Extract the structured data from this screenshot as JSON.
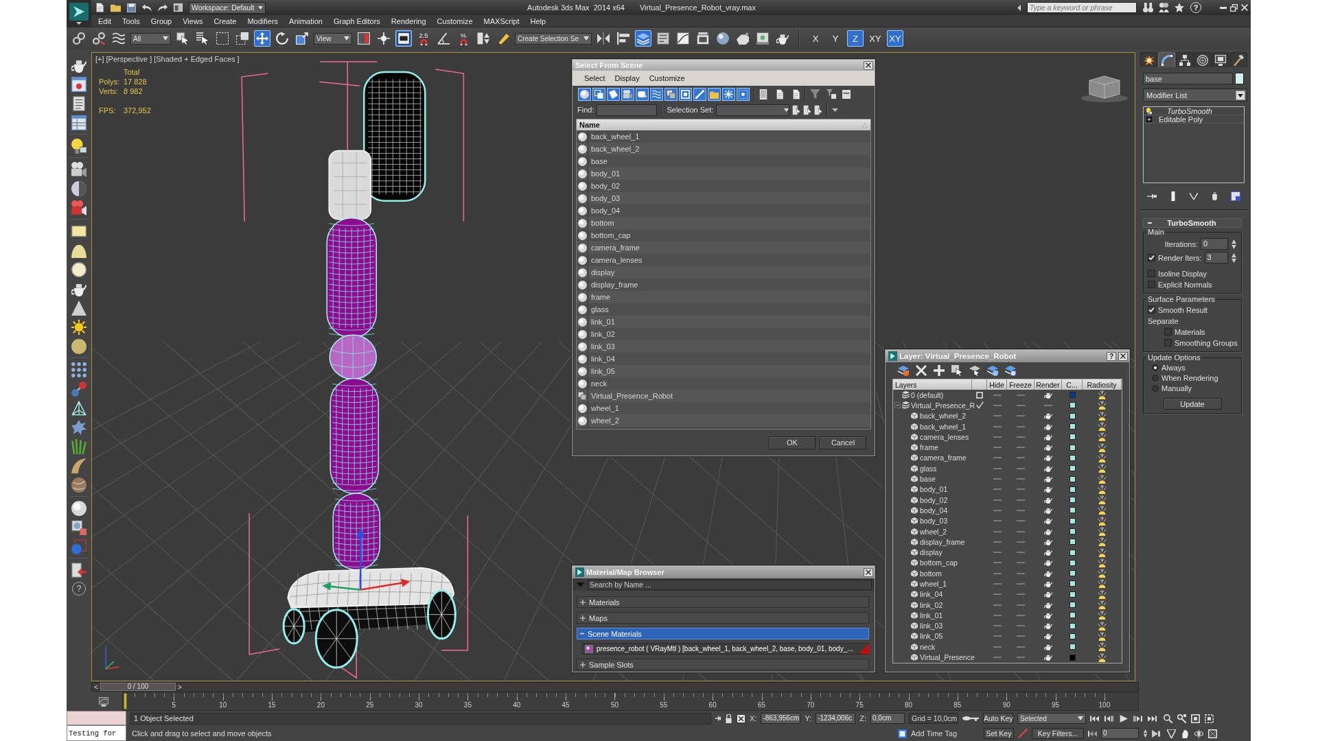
{
  "window": {
    "title": "Autodesk 3ds Max  2014 x64",
    "file": "Virtual_Presence_Robot_vray.max",
    "workspace": "Workspace: Default",
    "search": {
      "placeholder": "Type a keyword or phrase"
    },
    "help": "?"
  },
  "menu": [
    "Edit",
    "Tools",
    "Group",
    "Views",
    "Create",
    "Modifiers",
    "Animation",
    "Graph Editors",
    "Rendering",
    "Customize",
    "MAXScript",
    "Help"
  ],
  "toolbar": {
    "items": [
      {
        "kind": "tool",
        "selected": false
      },
      {
        "kind": "tool",
        "selected": false
      },
      {
        "kind": "tool",
        "selected": false
      },
      {
        "kind": "dropdown",
        "value": "All"
      },
      {
        "kind": "tool",
        "selected": false
      },
      {
        "kind": "tool",
        "selected": false
      },
      {
        "kind": "tool",
        "selected": false
      },
      {
        "kind": "tool",
        "selected": false
      },
      {
        "kind": "tool",
        "selected": true
      },
      {
        "kind": "tool",
        "selected": false
      },
      {
        "kind": "tool",
        "selected": false
      },
      {
        "kind": "dropdown",
        "value": "View"
      },
      {
        "kind": "tool",
        "selected": false
      },
      {
        "kind": "tool",
        "selected": false
      },
      {
        "kind": "tool",
        "selected": true
      },
      {
        "kind": "tool",
        "label": "2.5",
        "selected": false
      },
      {
        "kind": "tool",
        "selected": false
      },
      {
        "kind": "tool",
        "label": "%",
        "selected": false
      },
      {
        "kind": "tool",
        "selected": false
      },
      {
        "kind": "tool",
        "selected": false
      },
      {
        "kind": "dropdown",
        "value": "Create Selection Se"
      },
      {
        "kind": "tool",
        "selected": false
      },
      {
        "kind": "tool",
        "selected": false
      },
      {
        "kind": "tool",
        "selected": true
      },
      {
        "kind": "tool",
        "selected": false
      },
      {
        "kind": "tool",
        "selected": false
      },
      {
        "kind": "tool",
        "selected": false
      },
      {
        "kind": "tool",
        "selected": false
      },
      {
        "kind": "tool",
        "selected": false
      },
      {
        "kind": "tool",
        "selected": false
      },
      {
        "kind": "tool",
        "selected": false
      },
      {
        "kind": "axis",
        "label": "X",
        "selected": false
      },
      {
        "kind": "axis",
        "label": "Y",
        "selected": false
      },
      {
        "kind": "axis",
        "label": "Z",
        "selected": true
      },
      {
        "kind": "axis",
        "label": "XY",
        "selected": false
      },
      {
        "kind": "axis",
        "label": "XY",
        "selected": true
      }
    ]
  },
  "left_toolbar": {
    "help": "?"
  },
  "viewport": {
    "labels": [
      "[+]",
      "[Perspective ]",
      "[Shaded + Edged Faces ]"
    ],
    "stats": {
      "heading": "Total",
      "rows": [
        {
          "label": "Polys:",
          "value": "17 828"
        },
        {
          "label": "Verts:",
          "value": "8 982"
        }
      ],
      "fps_label": "FPS:",
      "fps": "372,952"
    }
  },
  "command_panel": {
    "tabs": [
      {
        "selected": false
      },
      {
        "selected": true
      },
      {
        "selected": false
      },
      {
        "selected": false
      },
      {
        "selected": false
      },
      {
        "selected": false
      }
    ],
    "object_name": "base",
    "modifier_list": "Modifier List",
    "stack": [
      {
        "name": "TurboSmooth",
        "kind": "modifier"
      },
      {
        "name": "Editable Poly",
        "kind": "object"
      }
    ],
    "rollout": {
      "title": "TurboSmooth",
      "expanded": true,
      "groups": [
        {
          "title": "Main",
          "controls": [
            {
              "kind": "spinner",
              "label": "Iterations:",
              "value": "0"
            },
            {
              "kind": "check-spinner",
              "label": "Render Iters:",
              "value": "3",
              "checked": true
            },
            {
              "kind": "checkbox",
              "label": "Isoline Display",
              "checked": false
            },
            {
              "kind": "checkbox",
              "label": "Explicit Normals",
              "checked": false
            }
          ]
        },
        {
          "title": "Surface Parameters",
          "controls": [
            {
              "kind": "checkbox",
              "label": "Smooth Result",
              "checked": true
            },
            {
              "kind": "label",
              "label": "Separate",
              "children": [
                {
                  "kind": "checkbox",
                  "label": "Materials",
                  "checked": false
                },
                {
                  "kind": "checkbox",
                  "label": "Smoothing Groups",
                  "checked": false
                }
              ]
            }
          ]
        },
        {
          "title": "Update Options",
          "controls": [
            {
              "kind": "radio",
              "label": "Always",
              "selected": true
            },
            {
              "kind": "radio",
              "label": "When Rendering",
              "selected": false
            },
            {
              "kind": "radio",
              "label": "Manually",
              "selected": false
            },
            {
              "kind": "button",
              "label": "Update"
            }
          ]
        }
      ]
    }
  },
  "select_dialog": {
    "title": "Select From Scene",
    "menu": [
      "Select",
      "Display",
      "Customize"
    ],
    "filters": [
      {
        "selected": true
      },
      {
        "selected": true
      },
      {
        "selected": true
      },
      {
        "selected": true
      },
      {
        "selected": true
      },
      {
        "selected": true
      },
      {
        "selected": true
      },
      {
        "selected": true
      },
      {
        "selected": true
      },
      {
        "selected": true
      },
      {
        "selected": true
      },
      {
        "selected": true
      }
    ],
    "find_label": "Find:",
    "selection_set_label": "Selection Set:",
    "column": "Name",
    "items": [
      {
        "name": "back_wheel_1",
        "kind": "object"
      },
      {
        "name": "back_wheel_2",
        "kind": "object"
      },
      {
        "name": "base",
        "kind": "object"
      },
      {
        "name": "body_01",
        "kind": "object"
      },
      {
        "name": "body_02",
        "kind": "object"
      },
      {
        "name": "body_03",
        "kind": "object"
      },
      {
        "name": "body_04",
        "kind": "object"
      },
      {
        "name": "bottom",
        "kind": "object"
      },
      {
        "name": "bottom_cap",
        "kind": "object"
      },
      {
        "name": "camera_frame",
        "kind": "object"
      },
      {
        "name": "camera_lenses",
        "kind": "object"
      },
      {
        "name": "display",
        "kind": "object"
      },
      {
        "name": "display_frame",
        "kind": "object"
      },
      {
        "name": "frame",
        "kind": "object"
      },
      {
        "name": "glass",
        "kind": "object"
      },
      {
        "name": "link_01",
        "kind": "object"
      },
      {
        "name": "link_02",
        "kind": "object"
      },
      {
        "name": "link_03",
        "kind": "object"
      },
      {
        "name": "link_04",
        "kind": "object"
      },
      {
        "name": "link_05",
        "kind": "object"
      },
      {
        "name": "neck",
        "kind": "object"
      },
      {
        "name": "Virtual_Presence_Robot",
        "kind": "group"
      },
      {
        "name": "wheel_1",
        "kind": "object"
      },
      {
        "name": "wheel_2",
        "kind": "object"
      }
    ],
    "buttons": [
      "OK",
      "Cancel"
    ]
  },
  "layer_dialog": {
    "title": "Layer: Virtual_Presence_Robot",
    "help": "?",
    "columns": [
      "Layers",
      "Hide",
      "Freeze",
      "Render",
      "C...",
      "Radiosity"
    ],
    "layers": [
      {
        "name": "0 (default)",
        "current": false,
        "renderable": true,
        "color": "#0b3a8c"
      },
      {
        "name": "Virtual_Presence_R",
        "current": true,
        "renderable": false,
        "expanded": true,
        "color": "#a6e6e3",
        "children": [
          {
            "name": "back_wheel_2",
            "color": "#a6e6e3"
          },
          {
            "name": "back_wheel_1",
            "color": "#a6e6e3"
          },
          {
            "name": "camera_lenses",
            "color": "#a6e6e3"
          },
          {
            "name": "frame",
            "color": "#a6e6e3"
          },
          {
            "name": "camera_frame",
            "color": "#a6e6e3"
          },
          {
            "name": "glass",
            "color": "#a6e6e3"
          },
          {
            "name": "base",
            "color": "#a6e6e3"
          },
          {
            "name": "body_01",
            "color": "#a6e6e3"
          },
          {
            "name": "body_02",
            "color": "#a6e6e3"
          },
          {
            "name": "body_04",
            "color": "#a6e6e3"
          },
          {
            "name": "body_03",
            "color": "#a6e6e3"
          },
          {
            "name": "wheel_2",
            "color": "#a6e6e3"
          },
          {
            "name": "display_frame",
            "color": "#a6e6e3"
          },
          {
            "name": "display",
            "color": "#a6e6e3"
          },
          {
            "name": "bottom_cap",
            "color": "#a6e6e3"
          },
          {
            "name": "bottom",
            "color": "#a6e6e3"
          },
          {
            "name": "wheel_1",
            "color": "#a6e6e3"
          },
          {
            "name": "link_04",
            "color": "#a6e6e3"
          },
          {
            "name": "link_02",
            "color": "#a6e6e3"
          },
          {
            "name": "link_01",
            "color": "#a6e6e3"
          },
          {
            "name": "link_03",
            "color": "#a6e6e3"
          },
          {
            "name": "link_05",
            "color": "#a6e6e3"
          },
          {
            "name": "neck",
            "color": "#a6e6e3"
          },
          {
            "name": "Virtual_Presence",
            "color": "#000000"
          }
        ]
      }
    ]
  },
  "material_browser": {
    "title": "Material/Map Browser",
    "search": {
      "placeholder": "Search by Name ..."
    },
    "sections": [
      {
        "title": "Materials",
        "expanded": false,
        "selected": false
      },
      {
        "title": "Maps",
        "expanded": false,
        "selected": false
      },
      {
        "title": "Scene Materials",
        "expanded": true,
        "selected": true,
        "items": [
          {
            "name": "presence_robot ( VRayMtl ) [back_wheel_1, back_wheel_2, base, body_01, body_...",
            "highlighted": true
          }
        ]
      },
      {
        "title": "Sample Slots",
        "expanded": false,
        "selected": false
      }
    ]
  },
  "timeline": {
    "prev": "<",
    "position": "0 / 100",
    "next": ">",
    "level": 0,
    "frames": [
      "5",
      "10",
      "15",
      "20",
      "25",
      "30",
      "35",
      "40",
      "45",
      "50",
      "55",
      "60",
      "65",
      "70",
      "75",
      "80",
      "85",
      "90",
      "95",
      "100"
    ]
  },
  "status": {
    "listener": "Testing for",
    "selection": "1 Object Selected",
    "prompt": "Click and drag to select and move objects",
    "x_label": "X:",
    "x": "-863,956cm",
    "y_label": "Y:",
    "y": "-1234,006c",
    "z_label": "Z:",
    "z": "0,0cm",
    "grid": "Grid = 10,0cm",
    "time_tag": "Add Time Tag",
    "auto_key": "Auto Key",
    "set_key": "Set Key",
    "key_mode": "Selected",
    "key_filters": "Key Filters...",
    "frame": "0"
  }
}
